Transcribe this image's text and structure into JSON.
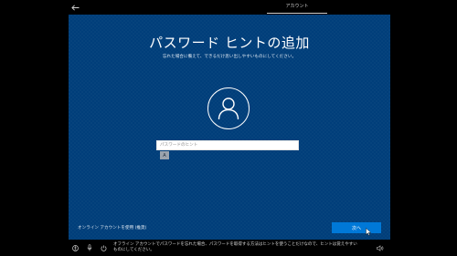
{
  "header": {
    "back_icon": "back-arrow-icon",
    "step_label": "アカウント"
  },
  "main": {
    "title": "パスワード ヒントの追加",
    "subtitle": "忘れた場合に備えて、できるだけ思い出しやすいものにしてください。",
    "avatar_icon": "user-icon",
    "hint_field": {
      "value": "",
      "placeholder": "パスワードのヒント"
    },
    "ime_indicator": "A",
    "online_account_link": "オンライン アカウントを使用 (推奨)",
    "next_button": "次へ"
  },
  "footer": {
    "icons": [
      "ease-of-access-icon",
      "microphone-icon",
      "power-icon",
      "volume-icon"
    ],
    "info_text": "オフライン アカウントでパスワードを忘れた場合、パスワードを取得する方法はヒントを使うことだけなので、ヒントは覚えやすいものにしてください。"
  },
  "colors": {
    "background": "#000000",
    "panel": "#003e7a",
    "accent": "#0078d7"
  }
}
